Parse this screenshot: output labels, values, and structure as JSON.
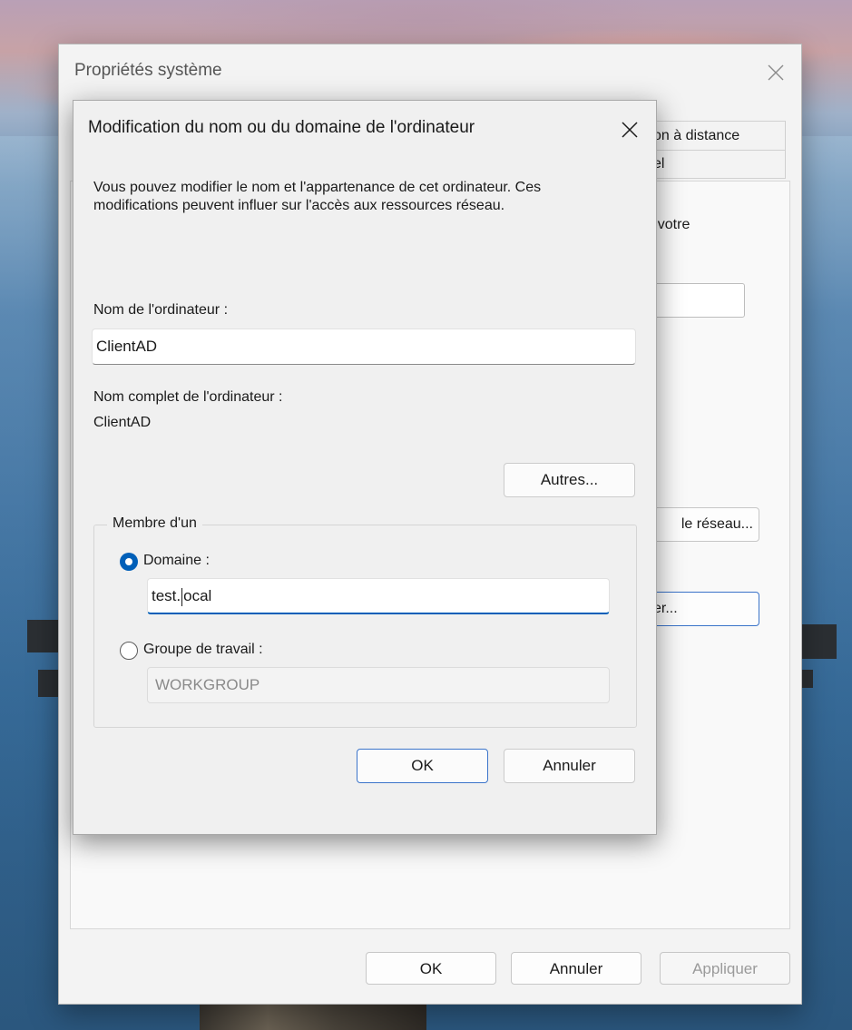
{
  "outer_dialog": {
    "title": "Propriétés système",
    "tab_row1_label": "on à distance",
    "tab_row2_label": "el",
    "desc_fragment": "r votre",
    "field_fragment": "u",
    "network_button_label": "le réseau...",
    "modify_button_label": "fier...",
    "ok_label": "OK",
    "cancel_label": "Annuler",
    "apply_label": "Appliquer"
  },
  "inner_dialog": {
    "title": "Modification du nom ou du domaine de l'ordinateur",
    "description": "Vous pouvez modifier le nom et l'appartenance de cet ordinateur. Ces modifications peuvent influer sur l'accès aux ressources réseau.",
    "computer_name_label": "Nom de l'ordinateur :",
    "computer_name_value": "ClientAD",
    "full_name_label": "Nom complet de l'ordinateur :",
    "full_name_value": "ClientAD",
    "more_button_label": "Autres...",
    "member_of_label": "Membre d'un",
    "domain_option_label": "Domaine :",
    "domain_value_before_caret": "test.",
    "domain_value_after_caret": "ocal",
    "workgroup_option_label": "Groupe de travail :",
    "workgroup_value": "WORKGROUP",
    "ok_label": "OK",
    "cancel_label": "Annuler",
    "selected_option": "Domaine"
  },
  "colors": {
    "accent": "#005fb8",
    "dialog_bg": "#f0f0f0",
    "disabled_text": "#8a8a8a"
  }
}
